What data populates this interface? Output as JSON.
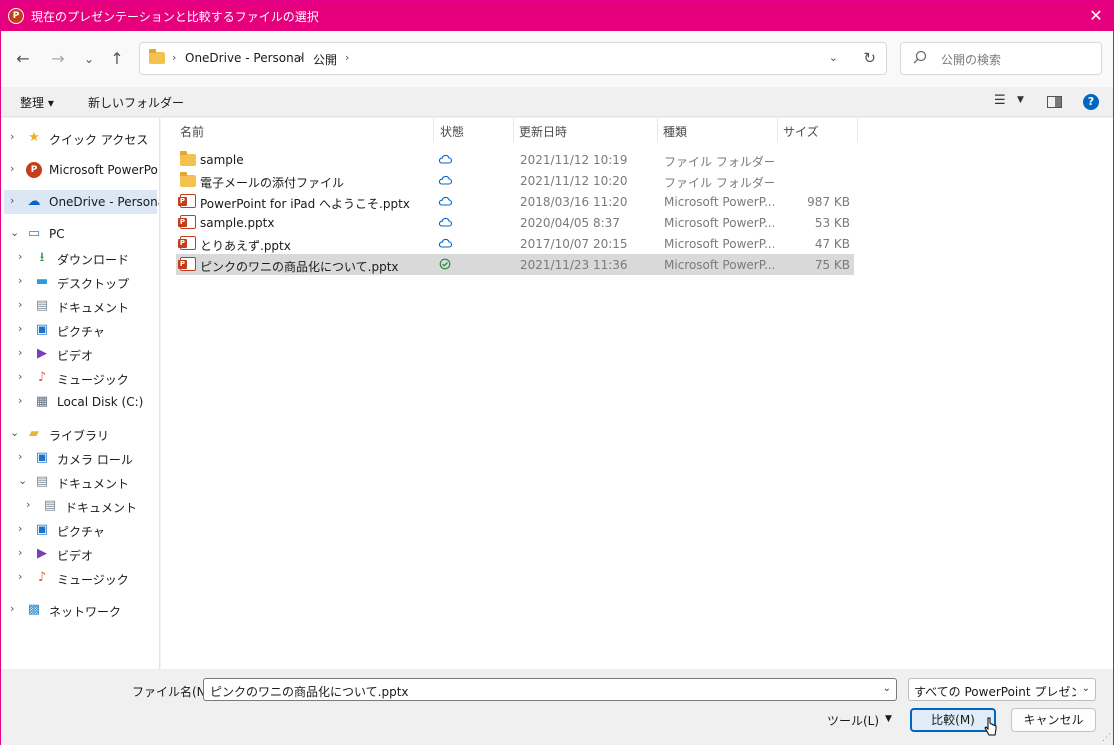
{
  "window": {
    "title": "現在のプレゼンテーションと比較するファイルの選択",
    "app_icon": "P",
    "close_glyph": "✕",
    "accent": "#e6007e"
  },
  "navbar": {
    "back": "←",
    "forward": "→",
    "recent": "⌄",
    "up": "↑",
    "breadcrumb": [
      "OneDrive - Personal",
      "公開"
    ],
    "search_placeholder": "公開の検索"
  },
  "cmdbar": {
    "organize": "整理 ▾",
    "new_folder": "新しいフォルダー",
    "help": "?"
  },
  "sidebar": {
    "items": [
      {
        "label": "クイック アクセス",
        "icon": "star-icon"
      },
      {
        "label": "Microsoft PowerPoint",
        "icon": "powerpoint-icon"
      },
      {
        "label": "OneDrive - Personal",
        "icon": "cloud-icon"
      },
      {
        "label": "PC",
        "icon": "pc-icon"
      },
      {
        "label": "ダウンロード",
        "icon": "download-icon"
      },
      {
        "label": "デスクトップ",
        "icon": "desktop-icon"
      },
      {
        "label": "ドキュメント",
        "icon": "document-icon"
      },
      {
        "label": "ピクチャ",
        "icon": "picture-icon"
      },
      {
        "label": "ビデオ",
        "icon": "video-icon"
      },
      {
        "label": "ミュージック",
        "icon": "music-icon"
      },
      {
        "label": "Local Disk (C:)",
        "icon": "disk-icon"
      },
      {
        "label": "ライブラリ",
        "icon": "library-icon"
      },
      {
        "label": "カメラ ロール",
        "icon": "picture-icon"
      },
      {
        "label": "ドキュメント",
        "icon": "document-icon"
      },
      {
        "label": "ドキュメント",
        "icon": "document-icon"
      },
      {
        "label": "ピクチャ",
        "icon": "picture-icon"
      },
      {
        "label": "ビデオ",
        "icon": "video-icon"
      },
      {
        "label": "ミュージック",
        "icon": "music-icon"
      },
      {
        "label": "ネットワーク",
        "icon": "network-icon"
      }
    ]
  },
  "columns": {
    "name": "名前",
    "status": "状態",
    "date": "更新日時",
    "type": "種類",
    "size": "サイズ"
  },
  "files": [
    {
      "name": "sample",
      "kind": "folder",
      "status": "cloud",
      "date": "2021/11/12 10:19",
      "type": "ファイル フォルダー",
      "size": ""
    },
    {
      "name": "電子メールの添付ファイル",
      "kind": "folder",
      "status": "cloud",
      "date": "2021/11/12 10:20",
      "type": "ファイル フォルダー",
      "size": ""
    },
    {
      "name": "PowerPoint for iPad へようこそ.pptx",
      "kind": "pptx",
      "status": "cloud",
      "date": "2018/03/16 11:20",
      "type": "Microsoft PowerP...",
      "size": "987 KB"
    },
    {
      "name": "sample.pptx",
      "kind": "pptx",
      "status": "cloud",
      "date": "2020/04/05 8:37",
      "type": "Microsoft PowerP...",
      "size": "53 KB"
    },
    {
      "name": "とりあえず.pptx",
      "kind": "pptx",
      "status": "cloud",
      "date": "2017/10/07 20:15",
      "type": "Microsoft PowerP...",
      "size": "47 KB"
    },
    {
      "name": "ピンクのワニの商品化について.pptx",
      "kind": "pptx",
      "status": "synced",
      "date": "2021/11/23 11:36",
      "type": "Microsoft PowerP...",
      "size": "75 KB"
    }
  ],
  "footer": {
    "filename_label": "ファイル名(N):",
    "filename_value": "ピンクのワニの商品化について.pptx",
    "filetype_value": "すべての PowerPoint プレゼンテーション",
    "tools_label": "ツール(L)",
    "compare_label": "比較(M)",
    "cancel_label": "キャンセル"
  }
}
